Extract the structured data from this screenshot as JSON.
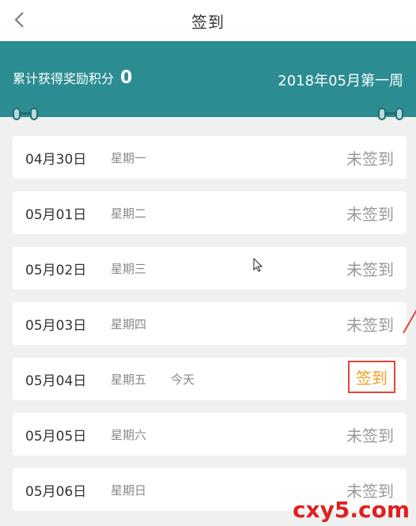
{
  "nav": {
    "title": "签到",
    "back_icon": "chevron-left-icon"
  },
  "banner": {
    "points_label": "累计获得奖励积分",
    "points_value": "0",
    "week_label": "2018年05月第一周",
    "color": "#2b8d92"
  },
  "days": [
    {
      "date": "04月30日",
      "weekday": "星期一",
      "today": "",
      "status": "未签到"
    },
    {
      "date": "05月01日",
      "weekday": "星期二",
      "today": "",
      "status": "未签到"
    },
    {
      "date": "05月02日",
      "weekday": "星期三",
      "today": "",
      "status": "未签到"
    },
    {
      "date": "05月03日",
      "weekday": "星期四",
      "today": "",
      "status": "未签到"
    },
    {
      "date": "05月04日",
      "weekday": "星期五",
      "today": "今天",
      "status": "签到"
    },
    {
      "date": "05月05日",
      "weekday": "星期六",
      "today": "",
      "status": "未签到"
    },
    {
      "date": "05月06日",
      "weekday": "星期日",
      "today": "",
      "status": "未签到"
    }
  ],
  "watermark": "cxy5.com"
}
